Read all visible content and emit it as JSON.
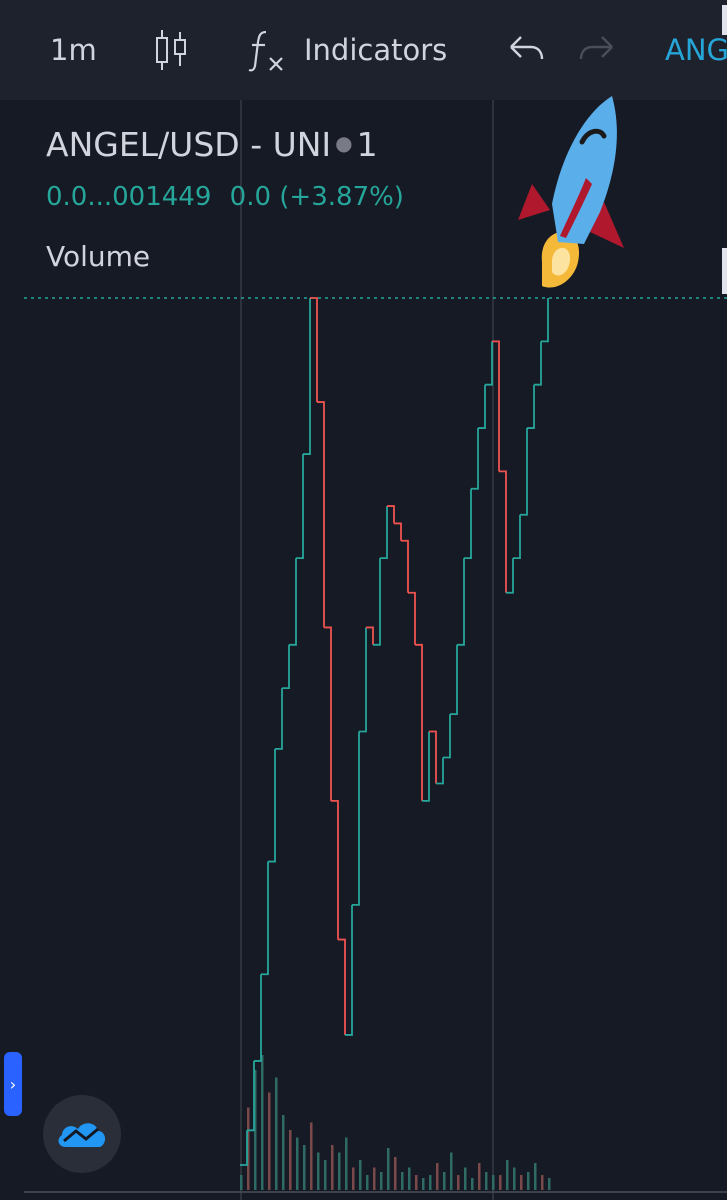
{
  "toolbar": {
    "interval": "1m",
    "indicators_label": "Indicators",
    "symbol_short": "ANG"
  },
  "legend": {
    "title": "ANGEL/USD - UNI",
    "interval": "1",
    "price": "0.0...001449",
    "change": "0.0 (+3.87%)",
    "volume_label": "Volume"
  },
  "colors": {
    "background": "#161a25",
    "toolbar": "#1e222d",
    "up": "#26a69a",
    "down": "#ef5350",
    "accent": "#2962ff",
    "price_line": "#26a69a"
  },
  "icons": [
    "candlestick-icon",
    "fx-icon",
    "undo-icon",
    "redo-icon",
    "rocket-emoji-icon",
    "chevron-right-icon",
    "tradingview-cloud-icon"
  ],
  "chart_data": {
    "type": "candlestick-line",
    "title": "ANGEL/USD - UNI",
    "interval": "1",
    "last_price": "0.0...001449",
    "change_percent": "+3.87%",
    "price_series_relative": [
      0.0,
      0.04,
      0.12,
      0.22,
      0.35,
      0.48,
      0.55,
      0.6,
      0.7,
      0.82,
      1.0,
      0.88,
      0.62,
      0.42,
      0.26,
      0.15,
      0.3,
      0.5,
      0.62,
      0.6,
      0.7,
      0.76,
      0.74,
      0.72,
      0.66,
      0.6,
      0.42,
      0.5,
      0.44,
      0.47,
      0.52,
      0.6,
      0.7,
      0.78,
      0.85,
      0.9,
      0.95,
      0.8,
      0.66,
      0.7,
      0.75,
      0.85,
      0.9,
      0.95,
      1.0
    ],
    "volume_relative": [
      0.1,
      0.55,
      0.8,
      0.9,
      0.65,
      0.75,
      0.5,
      0.4,
      0.35,
      0.3,
      0.45,
      0.25,
      0.2,
      0.3,
      0.25,
      0.35,
      0.15,
      0.2,
      0.1,
      0.15,
      0.12,
      0.28,
      0.22,
      0.12,
      0.15,
      0.1,
      0.08,
      0.1,
      0.18,
      0.12,
      0.25,
      0.1,
      0.15,
      0.08,
      0.18,
      0.12,
      0.1,
      0.1,
      0.2,
      0.15,
      0.1,
      0.12,
      0.18,
      0.1,
      0.08
    ]
  }
}
